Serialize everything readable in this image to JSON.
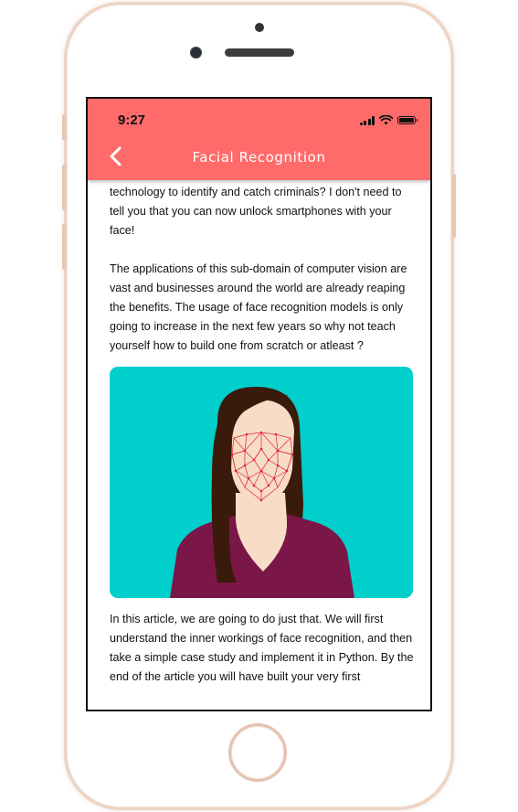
{
  "status_bar": {
    "time": "9:27"
  },
  "app_bar": {
    "title": "Facial Recognition",
    "back_icon": "chevron-left-icon"
  },
  "article": {
    "paragraph_1": "technology to identify and catch criminals? I don't need to tell you that you can now unlock smartphones with your face!",
    "paragraph_2": "The applications of this sub-domain of computer vision are vast and businesses around the world are already reaping the benefits. The usage of face recognition models is only going to increase in the next few years so why not teach yourself how to build one from scratch or atleast ?",
    "paragraph_3": "In this article, we are going to do just that. We will first understand the inner workings of face recognition, and then take a simple case study and implement it in Python. By the end of the article you will have built your very first"
  },
  "colors": {
    "app_bar": "#ff6b6a",
    "hero_background": "#00cfcb",
    "shirt": "#7b1748",
    "hair": "#3a1a0a",
    "skin": "#f7dcc6",
    "mesh": "#e0223a"
  }
}
